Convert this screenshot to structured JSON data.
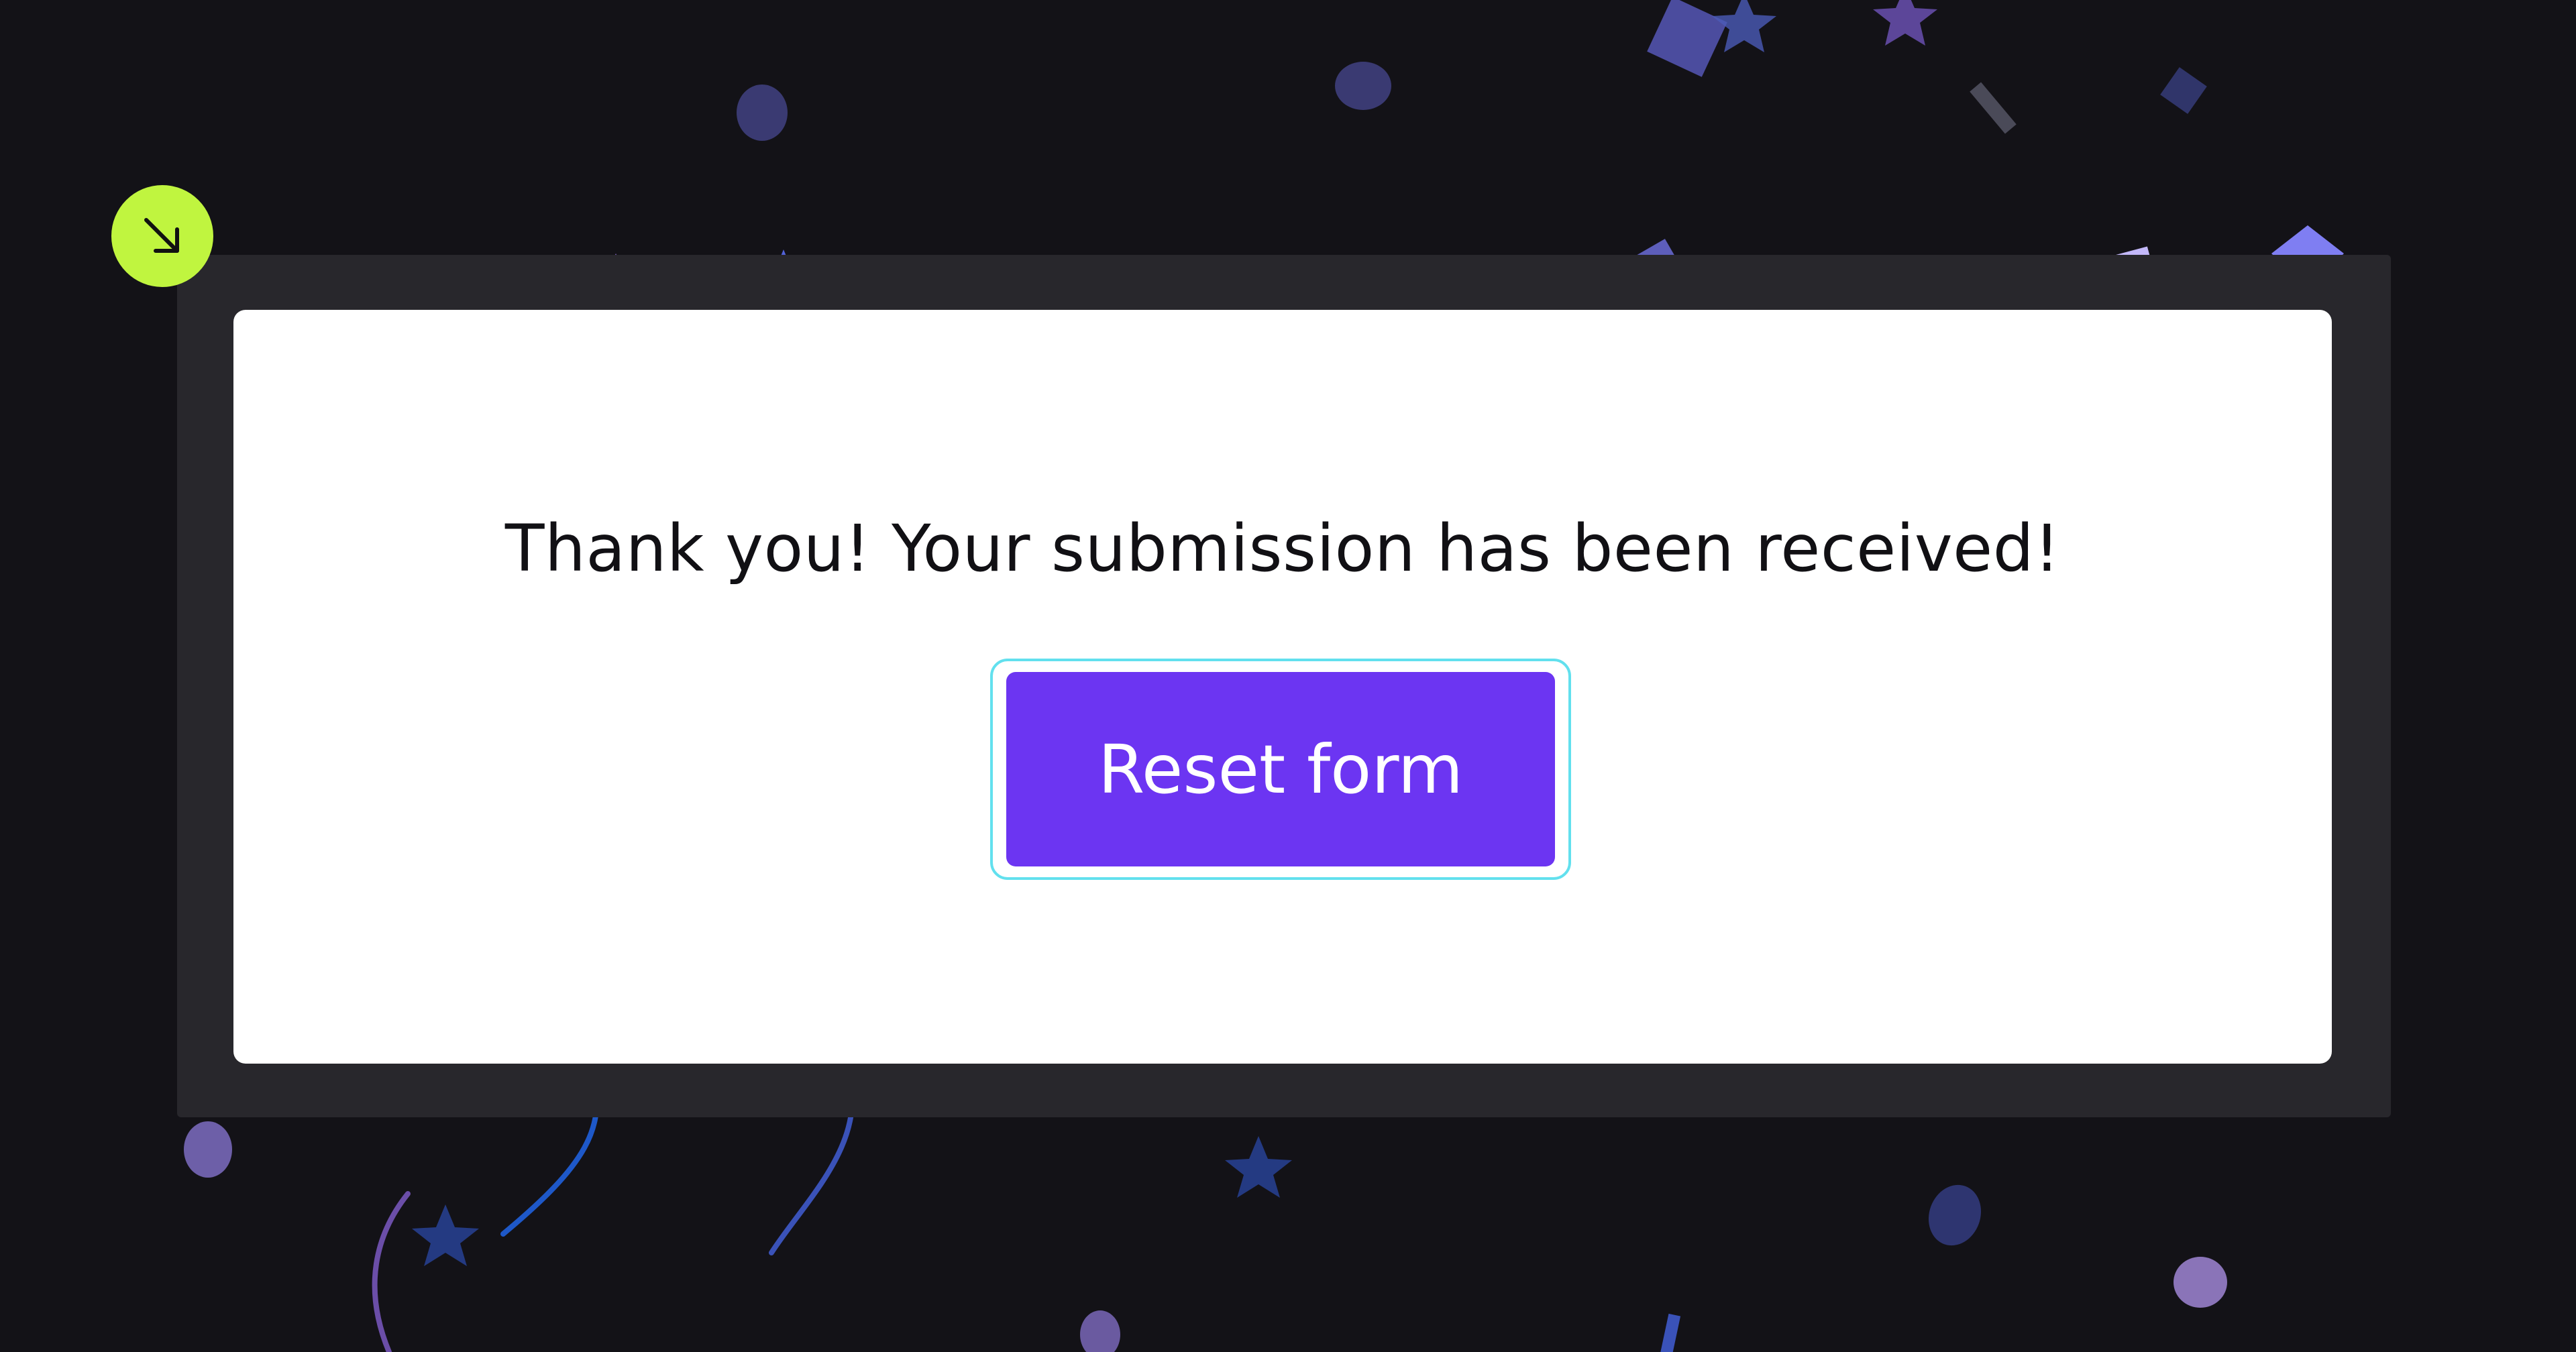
{
  "confirmation": {
    "message": "Thank you! Your submission has been received!",
    "reset_label": "Reset form"
  },
  "badge": {
    "icon": "arrow-down-right-icon"
  },
  "colors": {
    "background": "#131217",
    "frame": "#28272c",
    "card": "#ffffff",
    "button": "#6c35f2",
    "focus_ring": "#62e0ee",
    "badge": "#c0f53f"
  }
}
